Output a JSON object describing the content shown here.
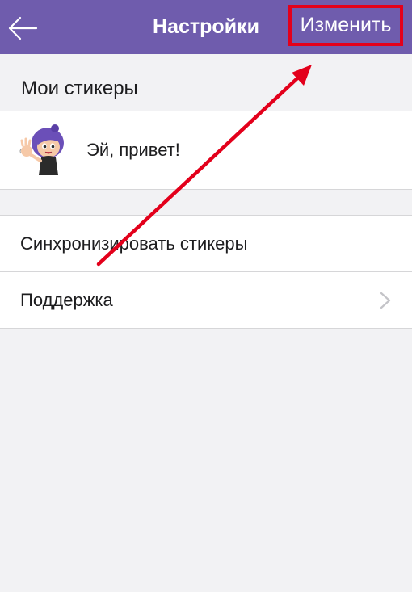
{
  "navbar": {
    "title": "Настройки",
    "edit_label": "Изменить",
    "back_icon": "arrow-left-icon",
    "color": "#6f5cad"
  },
  "my_stickers": {
    "header": "Мои стикеры",
    "items": [
      {
        "label": "Эй, привет!",
        "icon": "waving-girl-sticker"
      }
    ]
  },
  "settings": {
    "items": [
      {
        "label": "Синхронизировать стикеры"
      },
      {
        "label": "Поддержка",
        "icon": "chevron-right-icon"
      }
    ]
  },
  "annotation": {
    "highlight_color": "#e3001b"
  }
}
